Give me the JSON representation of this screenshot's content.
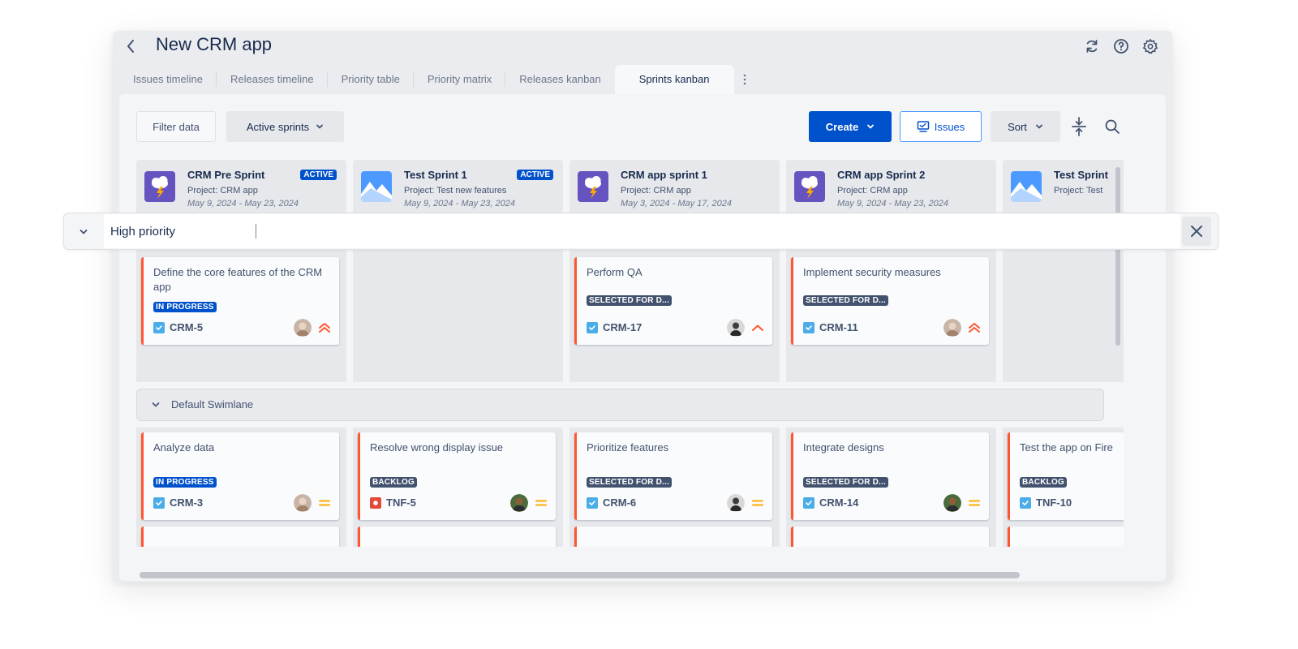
{
  "app": {
    "title": "New CRM app"
  },
  "tabs": [
    {
      "label": "Issues timeline"
    },
    {
      "label": "Releases timeline"
    },
    {
      "label": "Priority table"
    },
    {
      "label": "Priority matrix"
    },
    {
      "label": "Releases kanban"
    },
    {
      "label": "Sprints kanban",
      "active": true
    }
  ],
  "toolbar": {
    "filter_label": "Filter data",
    "active_sprints_label": "Active sprints",
    "create_label": "Create",
    "issues_label": "Issues",
    "sort_label": "Sort"
  },
  "columns": [
    {
      "name": "CRM Pre Sprint",
      "project": "Project: CRM app",
      "dates": "May 9, 2024 - May 23, 2024",
      "badge": "ACTIVE",
      "icon": "storm-icon"
    },
    {
      "name": "Test Sprint 1",
      "project": "Project: Test new features",
      "dates": "May 9, 2024 - May 23, 2024",
      "badge": "ACTIVE",
      "icon": "mountain-icon"
    },
    {
      "name": "CRM app sprint 1",
      "project": "Project: CRM app",
      "dates": "May 3, 2024 - May 17, 2024",
      "icon": "storm-icon"
    },
    {
      "name": "CRM app Sprint 2",
      "project": "Project: CRM app",
      "dates": "May 9, 2024 - May 23, 2024",
      "icon": "storm-icon"
    },
    {
      "name": "Test Sprint",
      "project": "Project: Test",
      "icon": "mountain-icon"
    }
  ],
  "high_priority_cards": [
    {
      "title": "Define the core features of the CRM app",
      "status": "IN PROGRESS",
      "key": "CRM-5",
      "priority": "highest"
    },
    {
      "title": "Perform QA",
      "status": "SELECTED FOR D...",
      "key": "CRM-17",
      "priority": "high"
    },
    {
      "title": "Implement security measures",
      "status": "SELECTED FOR D...",
      "key": "CRM-11",
      "priority": "highest"
    }
  ],
  "swimlane": {
    "name": "Default Swimlane"
  },
  "default_cards": [
    {
      "title": "Analyze data",
      "status": "IN PROGRESS",
      "key": "CRM-3",
      "priority": "medium"
    },
    {
      "title": "Resolve wrong display issue",
      "status": "BACKLOG",
      "key": "TNF-5",
      "priority": "medium"
    },
    {
      "title": "Prioritize features",
      "status": "SELECTED FOR D...",
      "key": "CRM-6",
      "priority": "medium"
    },
    {
      "title": "Integrate designs",
      "status": "SELECTED FOR D...",
      "key": "CRM-14",
      "priority": "medium"
    },
    {
      "title": "Test the app on Fire",
      "status": "BACKLOG",
      "key": "TNF-10"
    }
  ],
  "search": {
    "value": "High priority"
  },
  "colors": {
    "accent": "#0052cc",
    "priority_high": "#ff5630",
    "priority_medium": "#ffab00",
    "card_border": "#ff5630"
  }
}
